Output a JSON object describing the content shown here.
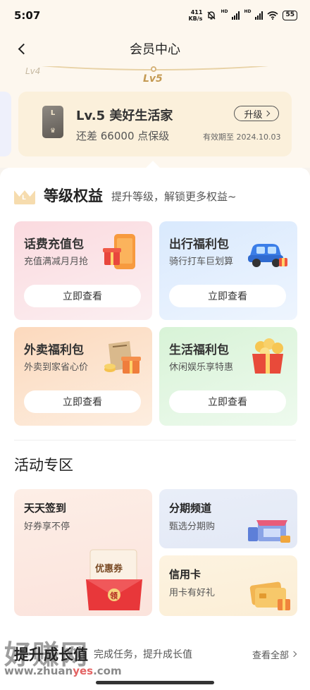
{
  "status_bar": {
    "time": "5:07",
    "net_speed": "411",
    "net_unit": "KB/s",
    "hd1": "HD",
    "hd2": "HD",
    "battery": "55",
    "icons": [
      "mute-bell-icon",
      "signal-icon",
      "signal-icon",
      "wifi-icon",
      "battery-icon"
    ]
  },
  "header": {
    "title": "会员中心",
    "back_icon": "chevron-left-icon"
  },
  "level_track": {
    "prev_level": "Lv4",
    "current_level": "Lv5"
  },
  "member_card": {
    "badge_letter": "L",
    "level_name": "Lv.5 美好生活家",
    "upgrade_label": "升级",
    "points_text": "还差 66000 点保级",
    "expire_text": "有效期至 2024.10.03"
  },
  "benefits": {
    "title": "等级权益",
    "subtitle": "提升等级，解锁更多权益~",
    "crown_letter": "L",
    "items": [
      {
        "title": "话费充值包",
        "subtitle": "充值满减月月抢",
        "button": "立即查看",
        "icon": "phone-gift-icon"
      },
      {
        "title": "出行福利包",
        "subtitle": "骑行打车巨划算",
        "button": "立即查看",
        "icon": "car-icon"
      },
      {
        "title": "外卖福利包",
        "subtitle": "外卖到家省心价",
        "button": "立即查看",
        "icon": "takeout-bag-icon"
      },
      {
        "title": "生活福利包",
        "subtitle": "休闲娱乐享特惠",
        "button": "立即查看",
        "icon": "popcorn-gift-icon"
      }
    ]
  },
  "activities": {
    "title": "活动专区",
    "items": [
      {
        "title": "天天签到",
        "subtitle": "好券享不停",
        "icon": "coupon-envelope-icon",
        "coupon_label": "优惠券",
        "coupon_action": "领"
      },
      {
        "title": "分期频道",
        "subtitle": "甄选分期购",
        "icon": "shop-icon"
      },
      {
        "title": "信用卡",
        "subtitle": "用卡有好礼",
        "icon": "credit-card-icon"
      }
    ]
  },
  "growth": {
    "title": "提升成长值",
    "subtitle": "完成任务，提升成长值",
    "view_all": "查看全部"
  },
  "watermark": {
    "text": "好赚网",
    "url_prefix": "www.zhuan",
    "url_accent": "yes",
    "url_suffix": ".com"
  },
  "colors": {
    "page_bg": "#fdf7ee",
    "card_bg": "#fbf0db",
    "level_gold": "#c49a53"
  }
}
